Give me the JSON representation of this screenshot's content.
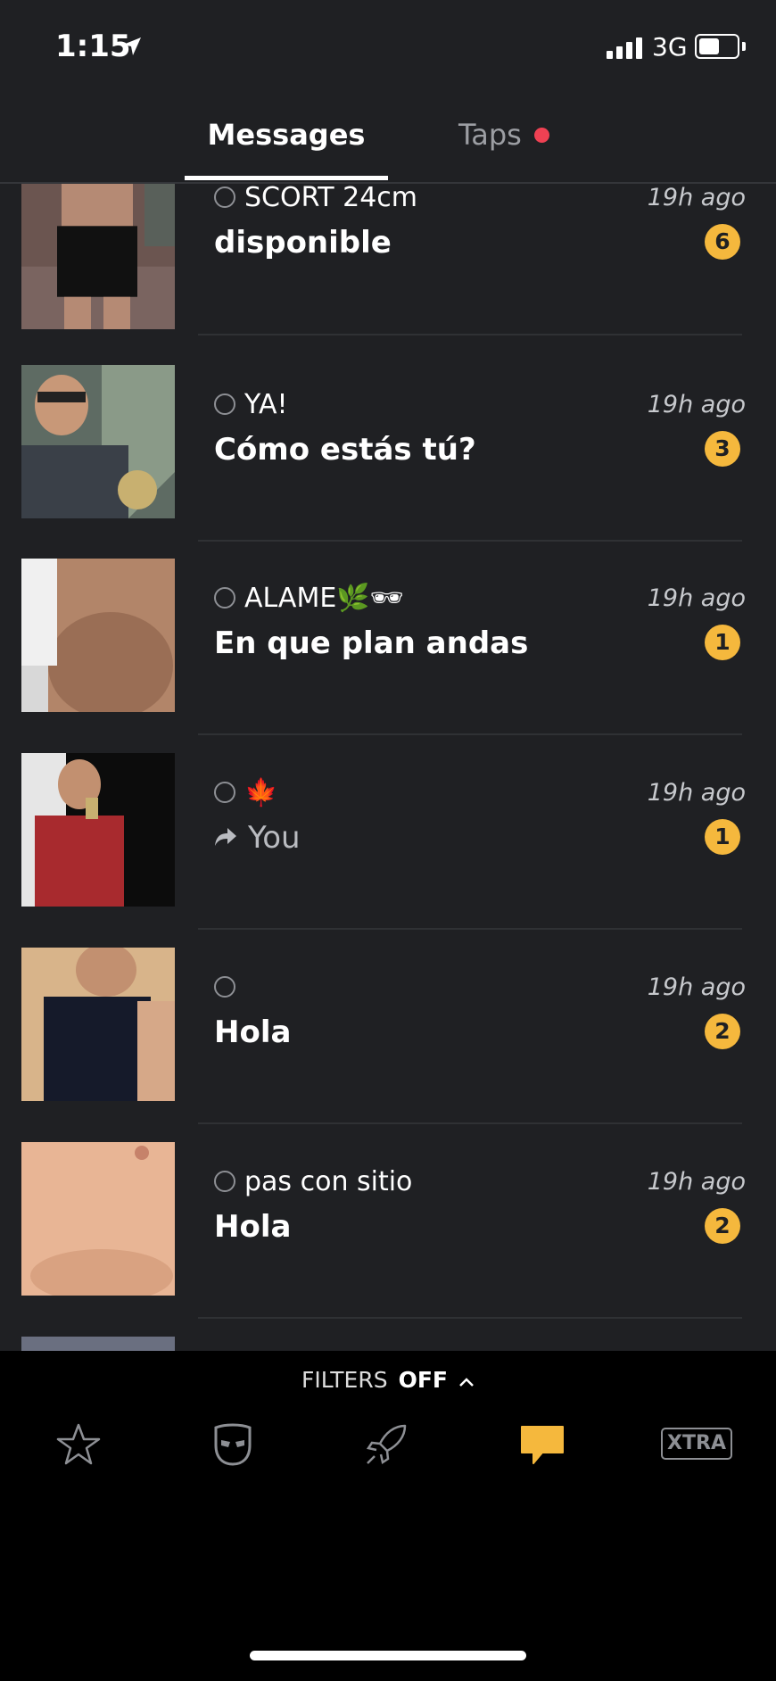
{
  "status_bar": {
    "time": "1:15",
    "network": "3G",
    "battery_level": 0.55
  },
  "tabs": {
    "messages_label": "Messages",
    "taps_label": "Taps"
  },
  "conversations": [
    {
      "name": "SCORT 24cm",
      "message": "disponible",
      "time": "19h ago",
      "unread": "6"
    },
    {
      "name": "YA!",
      "message": "Cómo estás tú?",
      "time": "19h ago",
      "unread": "3"
    },
    {
      "name": "ALAME🌿🕶",
      "message": "En que plan andas",
      "time": "19h ago",
      "unread": "1"
    },
    {
      "name": "🍁",
      "message": "You",
      "time": "19h ago",
      "unread": "1"
    },
    {
      "name": "",
      "message": "Hola",
      "time": "19h ago",
      "unread": "2"
    },
    {
      "name": "pas con sitio",
      "message": "Hola",
      "time": "19h ago",
      "unread": "2"
    }
  ],
  "filters": {
    "label": "FILTERS",
    "state": "OFF"
  },
  "bottom_nav": {
    "xtra_label": "XTRA"
  },
  "colors": {
    "accent": "#f5b83d",
    "taps_dot": "#ef4153",
    "background": "#1f2023"
  }
}
